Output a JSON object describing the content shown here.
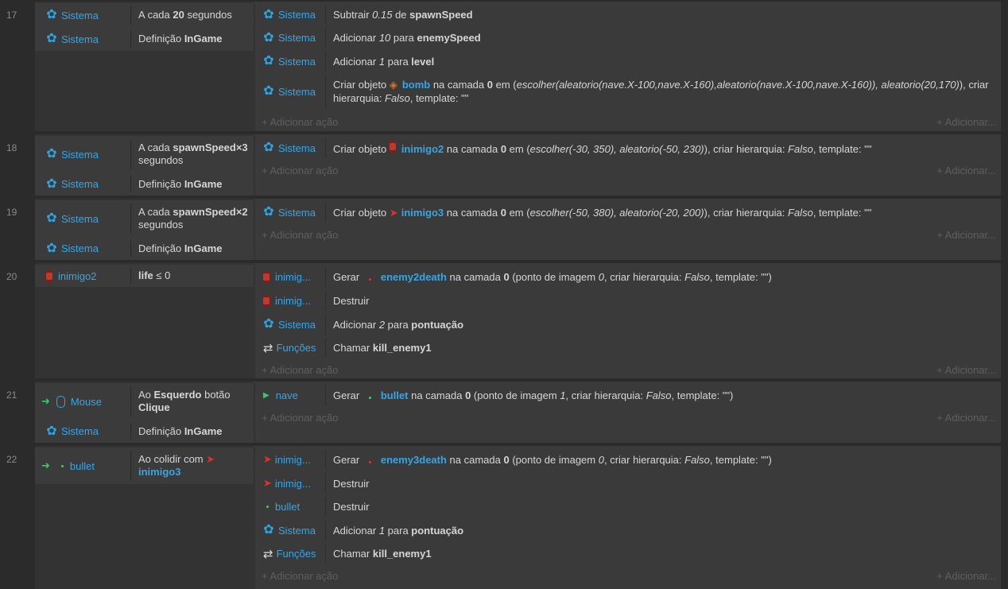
{
  "add_action": "+ Adicionar ação",
  "add_right": "+ Adicionar...",
  "events": {
    "e17": {
      "num": "17",
      "c1_obj": "Sistema",
      "c1_pre": "A cada ",
      "c1_val": "20",
      "c1_post": " segundos",
      "c2_obj": "Sistema",
      "c2_pre": "Definição ",
      "c2_val": "InGame",
      "a1_obj": "Sistema",
      "a1_pre": "Subtrair ",
      "a1_num": "0.15",
      "a1_mid": " de ",
      "a1_var": "spawnSpeed",
      "a2_obj": "Sistema",
      "a2_pre": "Adicionar ",
      "a2_num": "10",
      "a2_mid": " para ",
      "a2_var": "enemySpeed",
      "a3_obj": "Sistema",
      "a3_pre": "Adicionar ",
      "a3_num": "1",
      "a3_mid": " para ",
      "a3_var": "level",
      "a4_obj": "Sistema",
      "a4_pre": "Criar objeto ",
      "a4_target": "bomb",
      "a4_layer_pre": " na camada ",
      "a4_layer": "0",
      "a4_em": " em (",
      "a4_expr": "escolher(aleatorio(nave.X-100,nave.X-160),aleatorio(nave.X-100,nave.X-160)), aleatorio(20,170)",
      "a4_tail1": "), criar",
      "a4_tail2_pre": "hierarquia: ",
      "a4_false": "Falso",
      "a4_tail2_post": ", template: \"\""
    },
    "e18": {
      "num": "18",
      "c1_obj": "Sistema",
      "c1_pre": "A cada ",
      "c1_val": "spawnSpeed×3",
      "c1_post": "segundos",
      "c2_obj": "Sistema",
      "c2_pre": "Definição ",
      "c2_val": "InGame",
      "a1_obj": "Sistema",
      "a1_pre": "Criar objeto ",
      "a1_target": "inimigo2",
      "a1_layer_pre": " na camada ",
      "a1_layer": "0",
      "a1_em": " em (",
      "a1_expr": "escolher(-30, 350), aleatorio(-50, 230)",
      "a1_tail_pre": "), criar hierarquia: ",
      "a1_false": "Falso",
      "a1_tail_post": ", template: \"\""
    },
    "e19": {
      "num": "19",
      "c1_obj": "Sistema",
      "c1_pre": "A cada ",
      "c1_val": "spawnSpeed×2",
      "c1_post": "segundos",
      "c2_obj": "Sistema",
      "c2_pre": "Definição ",
      "c2_val": "InGame",
      "a1_obj": "Sistema",
      "a1_pre": "Criar objeto ",
      "a1_target": "inimigo3",
      "a1_layer_pre": " na camada ",
      "a1_layer": "0",
      "a1_em": " em (",
      "a1_expr": "escolher(-50, 380), aleatorio(-20, 200)",
      "a1_tail_pre": "), criar hierarquia: ",
      "a1_false": "Falso",
      "a1_tail_post": ", template: \"\""
    },
    "e20": {
      "num": "20",
      "c1_obj": "inimigo2",
      "c1_val": "life",
      "c1_post": " ≤ 0",
      "a1_obj": "inimig...",
      "a1_pre": "Gerar ",
      "a1_target": "enemy2death",
      "a1_layer_pre": " na camada ",
      "a1_layer": "0",
      "a1_tail1": " (ponto de imagem ",
      "a1_img": "0",
      "a1_tail2": ", criar hierarquia: ",
      "a1_false": "Falso",
      "a1_tail3": ", template: \"\")",
      "a2_obj": "inimig...",
      "a2_txt": "Destruir",
      "a3_obj": "Sistema",
      "a3_pre": "Adicionar ",
      "a3_num": "2",
      "a3_mid": " para ",
      "a3_var": "pontuação",
      "a4_obj": "Funções",
      "a4_pre": "Chamar ",
      "a4_var": "kill_enemy1"
    },
    "e21": {
      "num": "21",
      "c1_obj": "Mouse",
      "c1_pre": "Ao ",
      "c1_b1": "Esquerdo",
      "c1_mid": " botão",
      "c1_b2": "Clique",
      "c2_obj": "Sistema",
      "c2_pre": "Definição ",
      "c2_val": "InGame",
      "a1_obj": "nave",
      "a1_pre": "Gerar ",
      "a1_target": "bullet",
      "a1_layer_pre": " na camada ",
      "a1_layer": "0",
      "a1_tail1": " (ponto de imagem ",
      "a1_img": "1",
      "a1_tail2": ", criar hierarquia: ",
      "a1_false": "Falso",
      "a1_tail3": ", template: \"\")"
    },
    "e22": {
      "num": "22",
      "c1_obj": "bullet",
      "c1_pre": "Ao colidir com ",
      "c1_target": "inimigo3",
      "a1_obj": "inimig...",
      "a1_pre": "Gerar ",
      "a1_target": "enemy3death",
      "a1_layer_pre": " na camada ",
      "a1_layer": "0",
      "a1_tail1": " (ponto de imagem ",
      "a1_img": "0",
      "a1_tail2": ", criar hierarquia: ",
      "a1_false": "Falso",
      "a1_tail3": ", template: \"\")",
      "a2_obj": "inimig...",
      "a2_txt": "Destruir",
      "a3_obj": "bullet",
      "a3_txt": "Destruir",
      "a4_obj": "Sistema",
      "a4_pre": "Adicionar ",
      "a4_num": "1",
      "a4_mid": " para ",
      "a4_var": "pontuação",
      "a5_obj": "Funções",
      "a5_pre": "Chamar ",
      "a5_var": "kill_enemy1"
    }
  }
}
